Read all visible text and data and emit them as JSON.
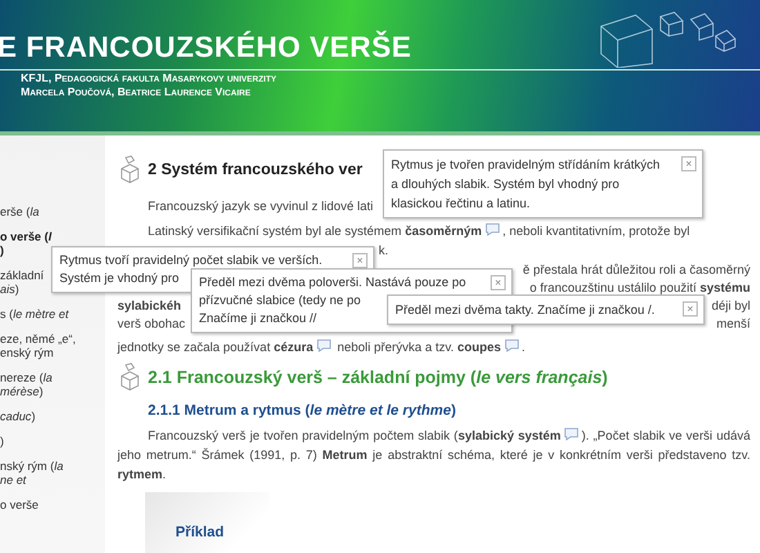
{
  "header": {
    "title": "E FRANCOUZSKÉHO VERŠE",
    "lines": [
      "KFJL, Pedagogická fakulta Masarykovy univerzity",
      "Marcela Poučová, Beatrice Laurence Vicaire"
    ]
  },
  "sidebar": {
    "items": [
      {
        "lines": [
          "erše (*la*"
        ],
        "selected": false
      },
      {
        "lines": [
          "o verše (*l*",
          ")"
        ],
        "selected": true
      },
      {
        "lines": [
          "základní",
          "*ais*)"
        ],
        "selected": false
      },
      {
        "lines": [
          "s (*le mètre et*"
        ],
        "selected": false
      },
      {
        "lines": [
          "eze, němé „e“,",
          "enský rým"
        ],
        "selected": false
      },
      {
        "lines": [
          "nereze (*la*",
          "*mérèse*)"
        ],
        "selected": false
      },
      {
        "lines": [
          "*caduc*)"
        ],
        "selected": false
      },
      {
        "lines": [
          ")"
        ],
        "selected": false
      },
      {
        "lines": [
          "nský rým (*la*",
          "*ne et*"
        ],
        "selected": false
      },
      {
        "lines": [
          "o verše"
        ],
        "selected": false
      }
    ]
  },
  "main": {
    "section_title": "2 Systém francouzského ver",
    "paragraph_1": "Francouzský jazyk se vyvinul z lidové lati",
    "paragraph_2": [
      [
        {
          "kind": "text",
          "text": "Latinský versifikační systém byl ale systémem **časoměrným**"
        },
        {
          "kind": "note"
        },
        {
          "kind": "text",
          "text": ", neboli kvantitativním, protože byl"
        }
      ],
      [
        {
          "kind": "text",
          "text": "k."
        }
      ]
    ],
    "paragraph_3": [
      {
        "right": "ě přestala hrát důležitou roli a časoměrný"
      },
      {
        "right": "o francouzštinu ustálilo použití **systému**"
      },
      {
        "left": "**sylabickéh**",
        "right": "déji byl"
      },
      {
        "left": "verš obohac",
        "right": "menší"
      }
    ],
    "paragraph_3_end": [
      {
        "kind": "text",
        "text": "jednotky se začala používat **cézura**"
      },
      {
        "kind": "note"
      },
      {
        "kind": "text",
        "text": " neboli přerývka a tzv. **coupes**"
      },
      {
        "kind": "note"
      },
      {
        "kind": "text",
        "text": "."
      }
    ],
    "subsection_title": "2.1 Francouzský verš – základní pojmy (*le vers français*)",
    "subsubsection_title": "2.1.1 Metrum a rytmus (*le mètre et le rythme*)",
    "paragraph_4": [
      {
        "kind": "text",
        "text": "Francouzský verš je tvořen pravidelným počtem slabik (**sylabický systém**"
      },
      {
        "kind": "note"
      },
      {
        "kind": "text",
        "text": "). „Počet slabik ve verši udává jeho metrum.“ Šrámek (1991, p. 7) **Metrum** je abstraktní schéma, které je v konkrétním verši představeno tzv. **rytmem**."
      }
    ],
    "example_title": "Příklad"
  },
  "tooltips": [
    {
      "lines": [
        "Rytmus je tvořen pravidelným střídáním krátkých",
        "a dlouhých slabik. Systém byl vhodný pro",
        "klasickou řečtinu a latinu."
      ],
      "close": "×"
    },
    {
      "lines": [
        "Rytmus tvoří pravidelný počet slabik ve verších.",
        "Systém je vhodný pro"
      ],
      "close": "×"
    },
    {
      "lines": [
        "Předěl mezi dvěma poloverši. Nastává pouze po",
        "přízvučné slabice (tedy ne po",
        "Značíme ji značkou //"
      ],
      "close": "×"
    },
    {
      "lines": [
        "Předěl mezi dvěma takty. Značíme ji značkou /."
      ],
      "close": "×"
    }
  ]
}
